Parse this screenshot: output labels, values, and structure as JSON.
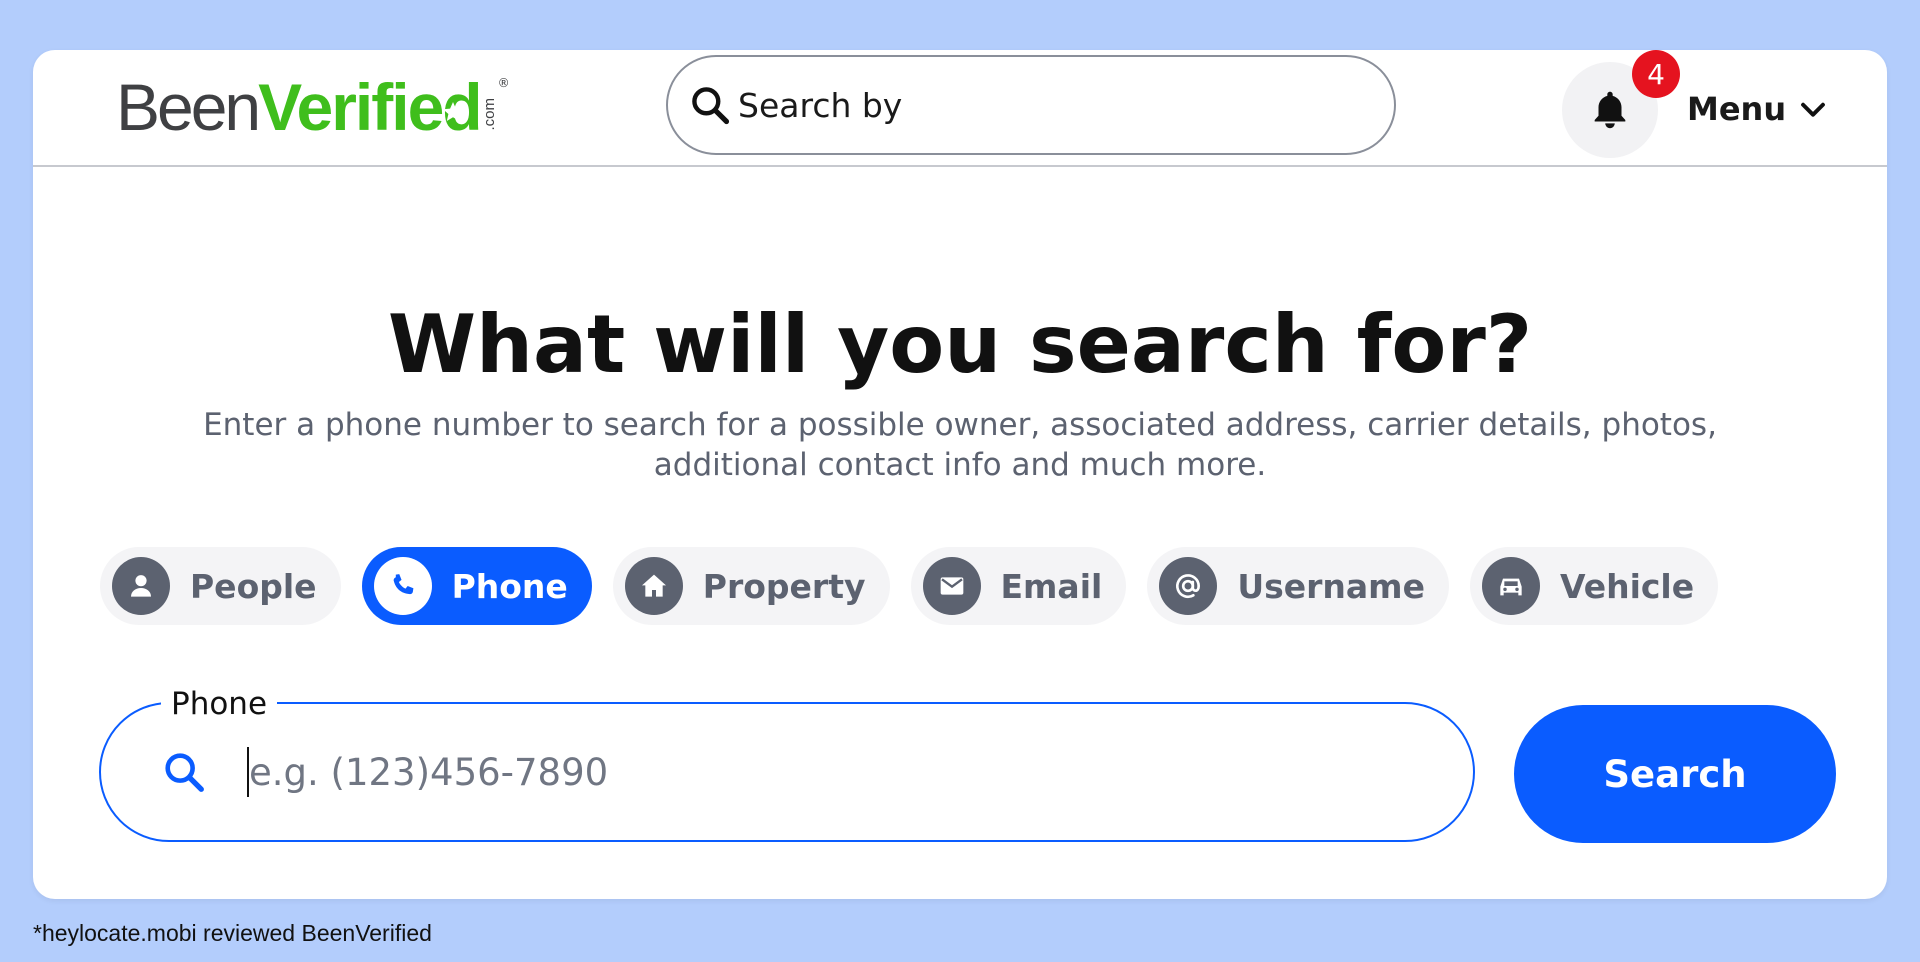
{
  "colors": {
    "background": "#b3cdfc",
    "accent": "#0a5cff",
    "badge": "#e5131f",
    "logo_green": "#3fbe1c",
    "muted": "#5c6270"
  },
  "header": {
    "logo": {
      "part1": "Been",
      "part2": "Verified",
      "suffix": ".com",
      "registered": "®"
    },
    "search_label": "Search by",
    "notifications": {
      "icon": "bell-icon",
      "count": "4"
    },
    "menu_label": "Menu"
  },
  "main": {
    "headline": "What will you search for?",
    "subtext": "Enter a phone number to search for a possible owner, associated address, carrier details, photos, additional contact info and much more.",
    "tabs": [
      {
        "label": "People",
        "icon": "person-icon",
        "active": false
      },
      {
        "label": "Phone",
        "icon": "phone-icon",
        "active": true
      },
      {
        "label": "Property",
        "icon": "house-icon",
        "active": false
      },
      {
        "label": "Email",
        "icon": "envelope-icon",
        "active": false
      },
      {
        "label": "Username",
        "icon": "at-sign-icon",
        "active": false
      },
      {
        "label": "Vehicle",
        "icon": "car-icon",
        "active": false
      }
    ],
    "phone_field": {
      "label": "Phone",
      "value": "",
      "placeholder": "e.g. (123)456-7890"
    },
    "search_button": "Search"
  },
  "footnote": "*heylocate.mobi reviewed BeenVerified"
}
